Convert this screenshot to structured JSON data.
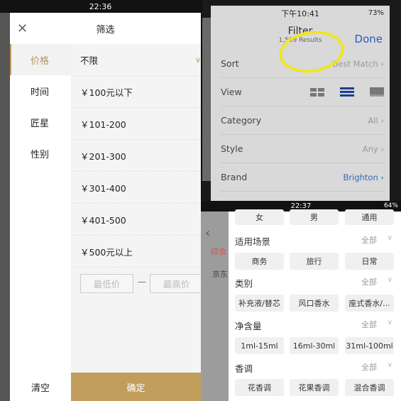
{
  "panel_a": {
    "status": {
      "time": "22:36"
    },
    "title": "筛选",
    "nav": [
      "价格",
      "时间",
      "匠星",
      "性别"
    ],
    "options": [
      "不限",
      "￥100元以下",
      "￥101-200",
      "￥201-300",
      "￥301-400",
      "￥401-500",
      "￥500元以上"
    ],
    "min_placeholder": "最低价",
    "max_placeholder": "最高价",
    "dash": "—",
    "clear": "清空",
    "confirm": "确定",
    "accent": "#c19d5c"
  },
  "panel_b": {
    "status": {
      "time": "下午10:41",
      "battery": "73%"
    },
    "title": "Filter",
    "results": "1,509 Results",
    "done": "Done",
    "rows": [
      {
        "label": "Sort",
        "value": "Best Match"
      },
      {
        "label": "View",
        "value": ""
      },
      {
        "label": "Category",
        "value": "All"
      },
      {
        "label": "Style",
        "value": "Any"
      },
      {
        "label": "Brand",
        "value": "Brighton"
      }
    ],
    "highlight_color": "#f2e51d"
  },
  "panel_c": {
    "status": {
      "time": "22:37",
      "battery": "64%"
    },
    "background_text": [
      "综合",
      "京东"
    ],
    "gender_chips": [
      "女",
      "男",
      "通用"
    ],
    "sections": [
      {
        "title": "适用场景",
        "value": "全部",
        "chips": [
          "商务",
          "旅行",
          "日常"
        ]
      },
      {
        "title": "类别",
        "value": "全部",
        "chips": [
          "补充液/替芯",
          "风口香水",
          "座式香水/..."
        ]
      },
      {
        "title": "净含量",
        "value": "全部",
        "chips": [
          "1ml-15ml",
          "16ml-30ml",
          "31ml-100ml"
        ]
      },
      {
        "title": "香调",
        "value": "全部",
        "chips": [
          "花香调",
          "花果香调",
          "混合香调"
        ]
      }
    ]
  }
}
